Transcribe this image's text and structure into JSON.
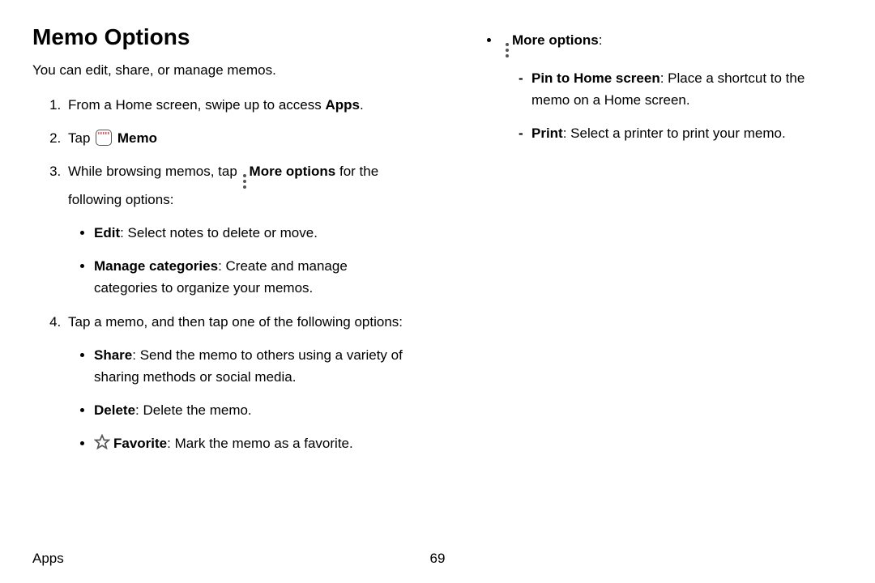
{
  "heading": "Memo Options",
  "intro": "You can edit, share, or manage memos.",
  "steps": {
    "s1": {
      "pre": "From a Home screen, swipe up to access ",
      "bold": "Apps",
      "post": "."
    },
    "s2": {
      "pre": "Tap ",
      "bold": "Memo"
    },
    "s3": {
      "pre": "While browsing memos, tap ",
      "bold": "More options",
      "post": " for the following options:"
    },
    "s3sub": {
      "edit": {
        "bold": "Edit",
        "desc": ": Select notes to delete or move."
      },
      "manage": {
        "bold": "Manage categories",
        "desc": ": Create and manage categories to organize your memos."
      }
    },
    "s4": "Tap a memo, and then tap one of the following options:",
    "s4sub": {
      "share": {
        "bold": "Share",
        "desc": ": Send the memo to others using a variety of sharing methods or social media."
      },
      "delete": {
        "bold": "Delete",
        "desc": ": Delete the memo."
      },
      "favorite": {
        "bold": "Favorite",
        "desc": ": Mark the memo as a favorite."
      }
    }
  },
  "rightcol": {
    "more": {
      "bold": "More options",
      "post": ":"
    },
    "pin": {
      "bold": "Pin to Home screen",
      "desc": ": Place a shortcut to the memo on a Home screen."
    },
    "print": {
      "bold": "Print",
      "desc": ": Select a printer to print your memo."
    }
  },
  "footer": {
    "section": "Apps",
    "page": "69"
  }
}
